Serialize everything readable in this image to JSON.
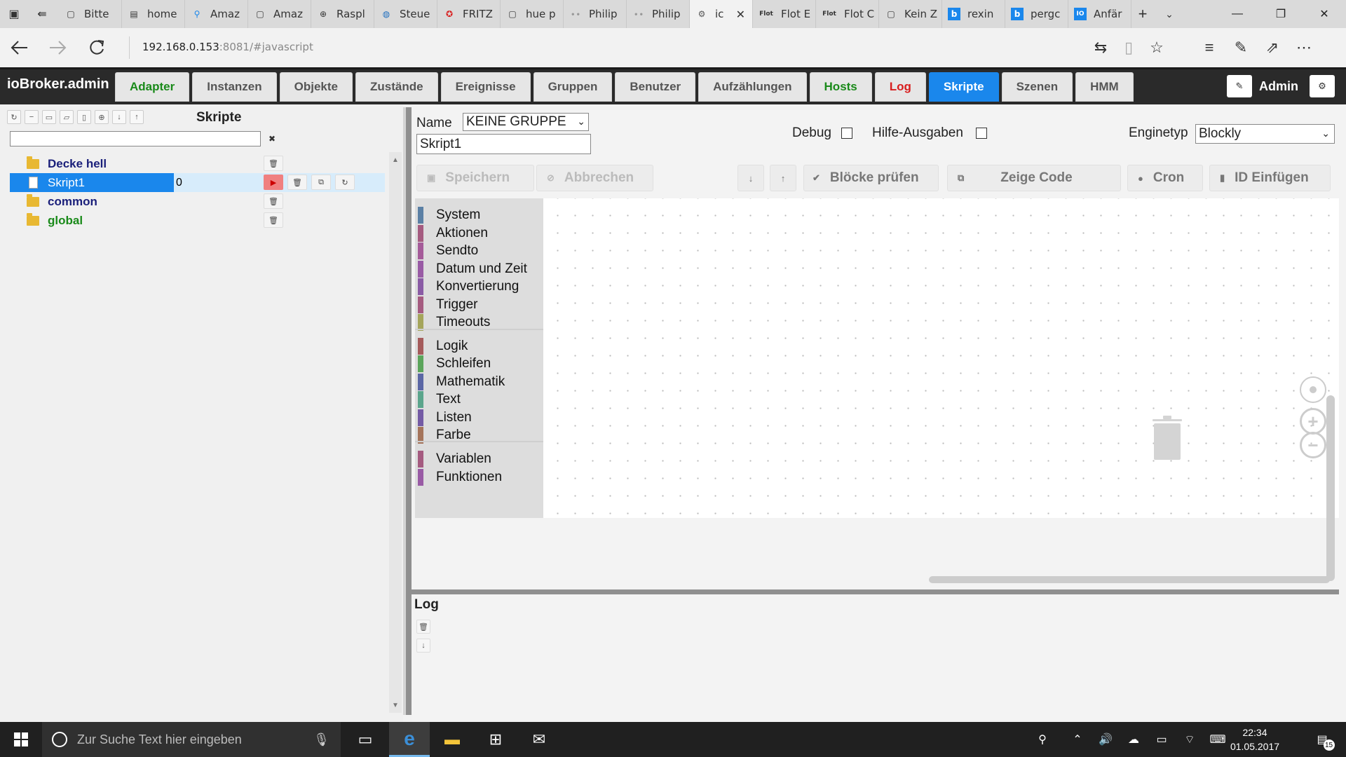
{
  "browser": {
    "tabs": [
      {
        "label": "Bitte",
        "icon": "page-icon"
      },
      {
        "label": "home",
        "icon": "doc-icon"
      },
      {
        "label": "Amaz",
        "icon": "map-pin-icon"
      },
      {
        "label": "Amaz",
        "icon": "page-icon"
      },
      {
        "label": "Raspl",
        "icon": "plus-circle-icon"
      },
      {
        "label": "Steue",
        "icon": "globe-icon"
      },
      {
        "label": "FRITZ",
        "icon": "fritz-icon"
      },
      {
        "label": "hue p",
        "icon": "page-icon"
      },
      {
        "label": "Philip",
        "icon": "philips-icon"
      },
      {
        "label": "Philip",
        "icon": "philips-icon"
      },
      {
        "label": "ic",
        "icon": "iobroker-icon",
        "active": true
      },
      {
        "label": "Flot E",
        "icon": "flot-icon"
      },
      {
        "label": "Flot C",
        "icon": "flot-icon"
      },
      {
        "label": "Kein Z",
        "icon": "page-icon"
      },
      {
        "label": "rexin",
        "icon": "bing-icon"
      },
      {
        "label": "pergc",
        "icon": "bing-icon"
      },
      {
        "label": "Anfär",
        "icon": "io-icon"
      }
    ],
    "flot_prefix": "Flot",
    "url_host": "192.168.0.153",
    "url_rest": ":8081/#javascript"
  },
  "app": {
    "brand": "ioBroker.admin",
    "tabs": [
      {
        "label": "Adapter",
        "style": "green"
      },
      {
        "label": "Instanzen",
        "style": ""
      },
      {
        "label": "Objekte",
        "style": ""
      },
      {
        "label": "Zustände",
        "style": ""
      },
      {
        "label": "Ereignisse",
        "style": ""
      },
      {
        "label": "Gruppen",
        "style": ""
      },
      {
        "label": "Benutzer",
        "style": ""
      },
      {
        "label": "Aufzählungen",
        "style": ""
      },
      {
        "label": "Hosts",
        "style": "green"
      },
      {
        "label": "Log",
        "style": "red"
      },
      {
        "label": "Skripte",
        "style": "active"
      },
      {
        "label": "Szenen",
        "style": ""
      },
      {
        "label": "HMM",
        "style": ""
      }
    ],
    "user": "Admin"
  },
  "scripts": {
    "title": "Skripte",
    "filter_value": "",
    "tree": [
      {
        "name": "Decke hell",
        "type": "folder",
        "color": "blue"
      },
      {
        "name": "Skript1",
        "type": "file",
        "selected": true,
        "value": "0"
      },
      {
        "name": "common",
        "type": "folder",
        "color": "blue"
      },
      {
        "name": "global",
        "type": "folder",
        "color": "green"
      }
    ]
  },
  "editor": {
    "name_label": "Name",
    "group": "KEINE GRUPPE",
    "script_name": "Skript1",
    "debug_label": "Debug",
    "help_label": "Hilfe-Ausgaben",
    "engine_label": "Enginetyp",
    "engine": "Blockly",
    "buttons": {
      "save": "Speichern",
      "cancel": "Abbrechen",
      "check": "Blöcke prüfen",
      "show_code": "Zeige Code",
      "cron": "Cron",
      "insert_id": "ID Einfügen"
    },
    "toolbox": [
      {
        "label": "System",
        "color": "#5b80a5"
      },
      {
        "label": "Aktionen",
        "color": "#a55b80"
      },
      {
        "label": "Sendto",
        "color": "#a55b99"
      },
      {
        "label": "Datum und Zeit",
        "color": "#995ba5"
      },
      {
        "label": "Konvertierung",
        "color": "#8a5ba5"
      },
      {
        "label": "Trigger",
        "color": "#a55b80"
      },
      {
        "label": "Timeouts",
        "color": "#a5a55b"
      },
      {
        "label": "Logik",
        "color": "#a55b5b"
      },
      {
        "label": "Schleifen",
        "color": "#5ba55b"
      },
      {
        "label": "Mathematik",
        "color": "#5b67a5"
      },
      {
        "label": "Text",
        "color": "#5ba58c"
      },
      {
        "label": "Listen",
        "color": "#745ba5"
      },
      {
        "label": "Farbe",
        "color": "#a5745b"
      },
      {
        "label": "Variablen",
        "color": "#a55b80"
      },
      {
        "label": "Funktionen",
        "color": "#995ba5"
      }
    ]
  },
  "log": {
    "title": "Log"
  },
  "taskbar": {
    "search_placeholder": "Zur Suche Text hier eingeben",
    "time": "22:34",
    "date": "01.05.2017",
    "notifications": "15"
  }
}
